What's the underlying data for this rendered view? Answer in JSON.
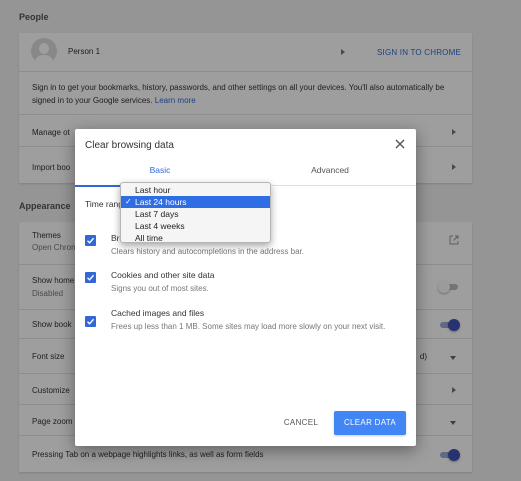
{
  "people": {
    "section_title": "People",
    "person_name": "Person 1",
    "sign_in_label": "SIGN IN TO CHROME",
    "description": "Sign in to get your bookmarks, history, passwords, and other settings on all your devices. You'll also automatically be signed in to your Google services.",
    "learn_more": "Learn more",
    "manage_label": "Manage ot",
    "import_label": "Import boo"
  },
  "appearance": {
    "section_title": "Appearance",
    "themes_label": "Themes",
    "themes_sub": "Open Chron",
    "show_home_label": "Show home",
    "show_home_sub": "Disabled",
    "show_bookmarks_label": "Show book",
    "font_size_label": "Font size",
    "font_size_value_tail": "d)",
    "customize_label": "Customize",
    "page_zoom_label": "Page zoom",
    "tab_highlight_label": "Pressing Tab on a webpage highlights links, as well as form fields"
  },
  "dialog": {
    "title": "Clear browsing data",
    "tabs": [
      {
        "label": "Basic",
        "active": true
      },
      {
        "label": "Advanced",
        "active": false
      }
    ],
    "time_range_label": "Time rang",
    "time_range_options": [
      "Last hour",
      "Last 24 hours",
      "Last 7 days",
      "Last 4 weeks",
      "All time"
    ],
    "time_range_selected": "Last 24 hours",
    "items": [
      {
        "title": "Bro",
        "desc": "Clears history and autocompletions in the address bar.",
        "checked": true
      },
      {
        "title": "Cookies and other site data",
        "desc": "Signs you out of most sites.",
        "checked": true
      },
      {
        "title": "Cached images and files",
        "desc": "Frees up less than 1 MB. Some sites may load more slowly on your next visit.",
        "checked": true
      }
    ],
    "cancel_label": "CANCEL",
    "clear_label": "CLEAR DATA"
  },
  "colors": {
    "accent": "#3367d6",
    "button": "#4285f4",
    "selected_option": "#2f6de5"
  }
}
